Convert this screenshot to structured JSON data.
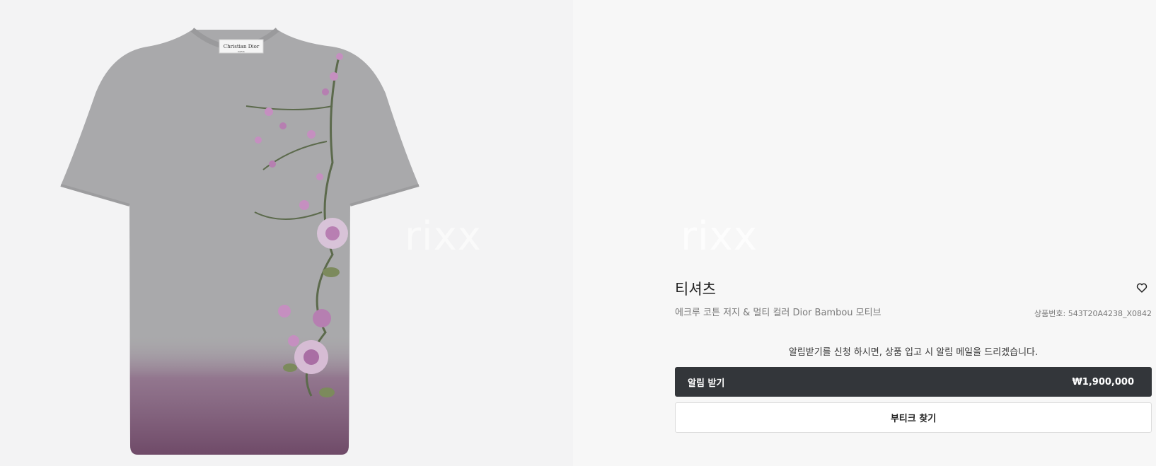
{
  "image": {
    "label_line1": "Christian Dior",
    "label_line2": "PARIS",
    "watermark": "rixx"
  },
  "product": {
    "title": "티셔츠",
    "subtitle": "에크루 코튼 저지 & 멀티 컬러 Dior Bambou 모티브",
    "sku": "상품번호: 543T20A4238_X0842",
    "watermark": "rixx"
  },
  "notice": "알림받기를 신청 하시면, 상품 입고 시 알림 메일을 드리겠습니다.",
  "buttons": {
    "notify_label": "알림 받기",
    "price": "₩1,900,000",
    "boutique_label": "부티크 찾기"
  },
  "icons": {
    "wishlist": "heart-icon"
  },
  "colors": {
    "primary_button": "#33363a",
    "image_background": "#f3f3f4",
    "tshirt_gray": "#a9a9ab",
    "dip_dye": "#7b4f72",
    "flower": "#c58fc0"
  }
}
